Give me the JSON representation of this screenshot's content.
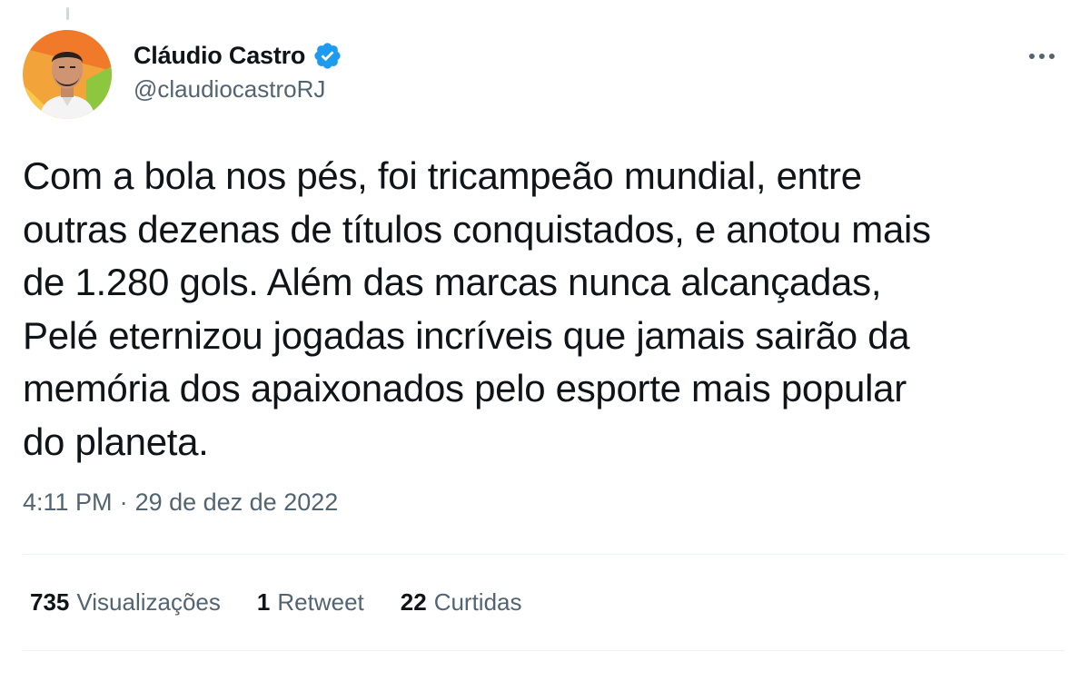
{
  "author": {
    "name": "Cláudio Castro",
    "handle": "@claudiocastroRJ",
    "verified": true
  },
  "icons": {
    "avatar": "profile-photo",
    "verified": "verified-badge-icon",
    "more": "more-options-icon"
  },
  "colors": {
    "verified_blue": "#1d9bf0",
    "text_primary": "#0f1419",
    "text_secondary": "#536471"
  },
  "tweet": {
    "text": "Com a bola nos pés, foi tricampeão mundial, entre\noutras dezenas de títulos conquistados, e anotou mais\nde 1.280 gols. Além das marcas nunca alcançadas,\nPelé eternizou jogadas incríveis que jamais sairão da\nmemória dos apaixonados pelo esporte mais popular\ndo planeta.",
    "time": "4:11 PM",
    "separator": "·",
    "date": "29 de dez de 2022"
  },
  "stats": {
    "views": {
      "count": "735",
      "label": "Visualizações"
    },
    "retweets": {
      "count": "1",
      "label": "Retweet"
    },
    "likes": {
      "count": "22",
      "label": "Curtidas"
    }
  }
}
